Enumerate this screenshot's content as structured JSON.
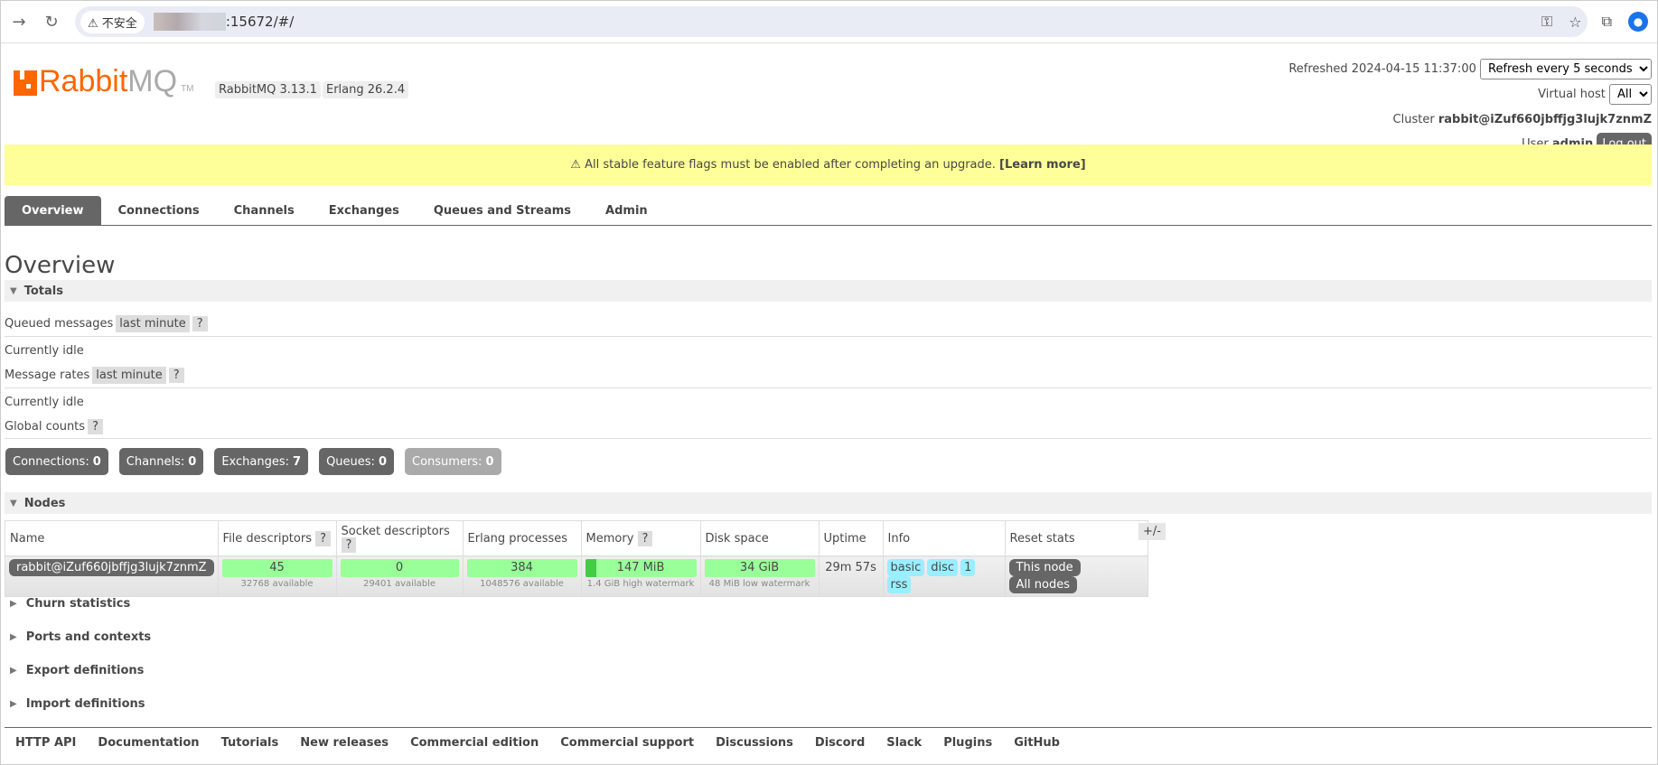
{
  "browser": {
    "security": "不安全",
    "url_suffix": ":15672/#/"
  },
  "header": {
    "brand_a": "Rabbit",
    "brand_b": "MQ",
    "tm": "TM",
    "rabbitmq_version": "RabbitMQ 3.13.1",
    "erlang_version": "Erlang 26.2.4",
    "refreshed_label": "Refreshed 2024-04-15 11:37:00",
    "refresh_option": "Refresh every 5 seconds",
    "vhost_label": "Virtual host",
    "vhost_option": "All",
    "cluster_label": "Cluster",
    "cluster_name": "rabbit@iZuf660jbffjg3lujk7znmZ",
    "user_label": "User",
    "user_name": "admin",
    "logout": "Log out"
  },
  "banner": {
    "text": "⚠ All stable feature flags must be enabled after completing an upgrade.",
    "link": "[Learn more]",
    "color": "#ffff99"
  },
  "tabs": [
    "Overview",
    "Connections",
    "Channels",
    "Exchanges",
    "Queues and Streams",
    "Admin"
  ],
  "page_title": "Overview",
  "totals": {
    "title": "Totals",
    "queued_label": "Queued messages",
    "queued_range": "last minute",
    "idle1": "Currently idle",
    "rates_label": "Message rates",
    "rates_range": "last minute",
    "idle2": "Currently idle",
    "global_label": "Global counts",
    "help": "?",
    "counts": [
      {
        "label": "Connections:",
        "value": "0"
      },
      {
        "label": "Channels:",
        "value": "0"
      },
      {
        "label": "Exchanges:",
        "value": "7"
      },
      {
        "label": "Queues:",
        "value": "0"
      },
      {
        "label": "Consumers:",
        "value": "0"
      }
    ]
  },
  "nodes": {
    "title": "Nodes",
    "columns": [
      "Name",
      "File descriptors",
      "Socket descriptors",
      "Erlang processes",
      "Memory",
      "Disk space",
      "Uptime",
      "Info",
      "Reset stats"
    ],
    "toggle": "+/-",
    "row": {
      "name": "rabbit@iZuf660jbffjg3lujk7znmZ",
      "fd": "45",
      "fd_sub": "32768 available",
      "sd": "0",
      "sd_sub": "29401 available",
      "ep": "384",
      "ep_sub": "1048576 available",
      "mem": "147 MiB",
      "mem_sub": "1.4 GiB high watermark",
      "mem_fraction": 0.1,
      "disk": "34 GiB",
      "disk_sub": "48 MiB low watermark",
      "uptime": "29m 57s",
      "info": [
        "basic",
        "disc",
        "1",
        "rss"
      ],
      "this_node": "This node",
      "all_nodes": "All nodes"
    }
  },
  "collapsed": [
    "Churn statistics",
    "Ports and contexts",
    "Export definitions",
    "Import definitions"
  ],
  "footer": [
    "HTTP API",
    "Documentation",
    "Tutorials",
    "New releases",
    "Commercial edition",
    "Commercial support",
    "Discussions",
    "Discord",
    "Slack",
    "Plugins",
    "GitHub"
  ]
}
